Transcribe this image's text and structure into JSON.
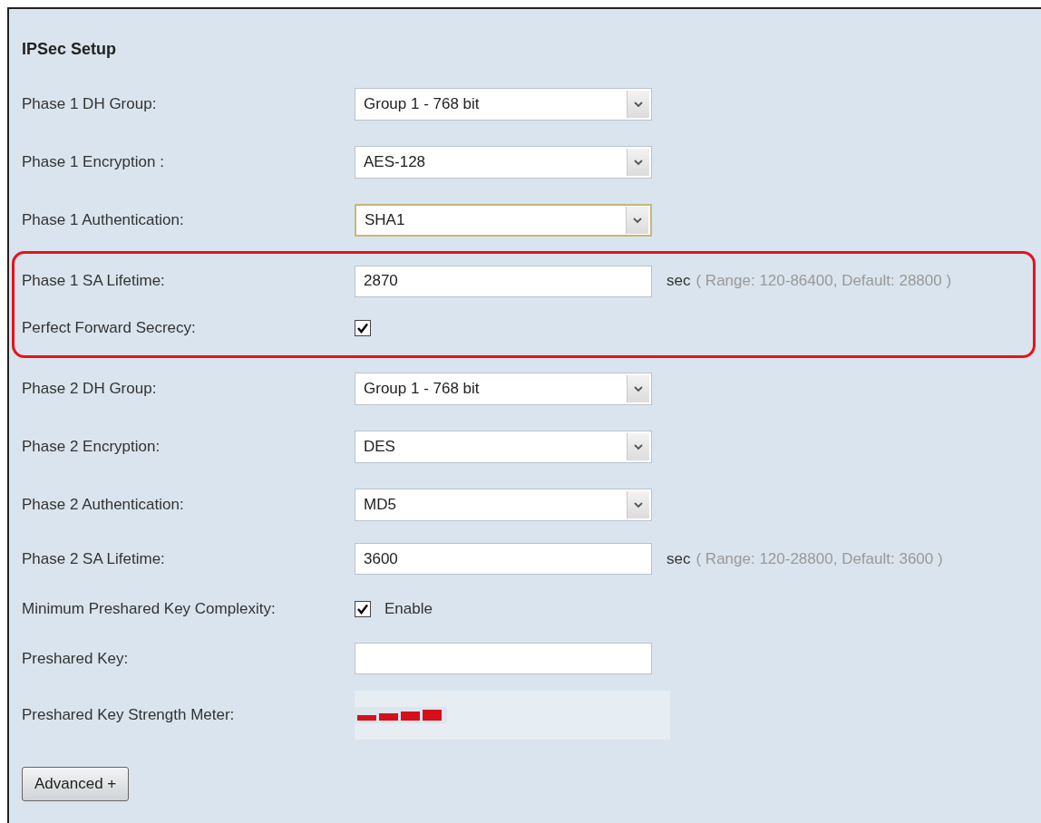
{
  "title": "IPSec Setup",
  "groups": [
    {
      "highlighted": false,
      "rows": [
        {
          "kind": "select",
          "label": "Phase 1 DH Group:",
          "value": "Group 1 - 768 bit",
          "focused": false
        },
        {
          "kind": "select",
          "label": "Phase 1 Encryption :",
          "value": "AES-128",
          "focused": false
        },
        {
          "kind": "select",
          "label": "Phase 1 Authentication:",
          "value": "SHA1",
          "focused": true
        }
      ]
    },
    {
      "highlighted": true,
      "rows": [
        {
          "kind": "text",
          "label": "Phase 1 SA Lifetime:",
          "value": "2870",
          "unit": "sec",
          "hint": "( Range: 120-86400, Default: 28800 )"
        },
        {
          "kind": "checkbox",
          "label": "Perfect Forward Secrecy:",
          "checked": true
        }
      ]
    },
    {
      "highlighted": false,
      "rows": [
        {
          "kind": "select",
          "label": "Phase 2 DH Group:",
          "value": "Group 1 - 768 bit",
          "focused": false
        },
        {
          "kind": "select",
          "label": "Phase 2 Encryption:",
          "value": "DES",
          "focused": false
        },
        {
          "kind": "select",
          "label": "Phase 2 Authentication:",
          "value": "MD5",
          "focused": false
        },
        {
          "kind": "text",
          "label": "Phase 2 SA Lifetime:",
          "value": "3600",
          "unit": "sec",
          "hint": "( Range: 120-28800, Default: 3600 )"
        },
        {
          "kind": "checkbox",
          "label": "Minimum Preshared Key Complexity:",
          "checked": true,
          "caption": "Enable"
        },
        {
          "kind": "text",
          "label": "Preshared Key:"
        },
        {
          "kind": "meter",
          "label": "Preshared Key Strength Meter:",
          "level": 1
        }
      ]
    }
  ],
  "button": "Advanced +"
}
